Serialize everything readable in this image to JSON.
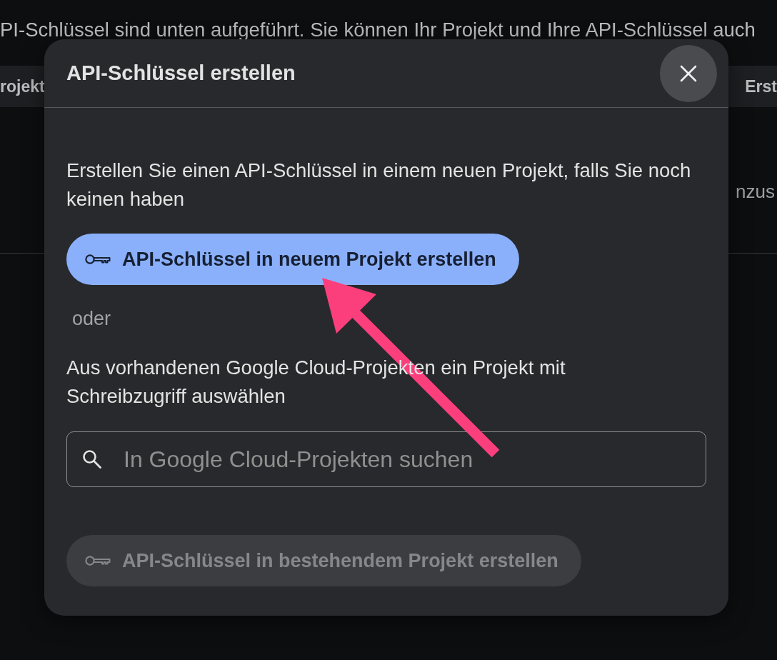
{
  "background_page": {
    "intro_text": "PI-Schlüssel sind unten aufgeführt. Sie können Ihr Projekt und Ihre API-Schlüssel auch",
    "table": {
      "column_1": "rojekt",
      "column_2": "Erst",
      "row_fragment": "nzus"
    }
  },
  "dialog": {
    "title": "API-Schlüssel erstellen",
    "new_project_text": "Erstellen Sie einen API-Schlüssel in einem neuen Projekt, falls Sie noch keinen haben",
    "primary_button": {
      "label": "API-Schlüssel in neuem Projekt erstellen",
      "disabled": false
    },
    "separator_text": "oder",
    "existing_project_text": "Aus vorhandenen Google Cloud-Projekten ein Projekt mit Schreibzugriff auswählen",
    "search": {
      "placeholder": "In Google Cloud-Projekten suchen"
    },
    "secondary_button": {
      "label": "API-Schlüssel in bestehendem Projekt erstellen",
      "disabled": true
    }
  }
}
